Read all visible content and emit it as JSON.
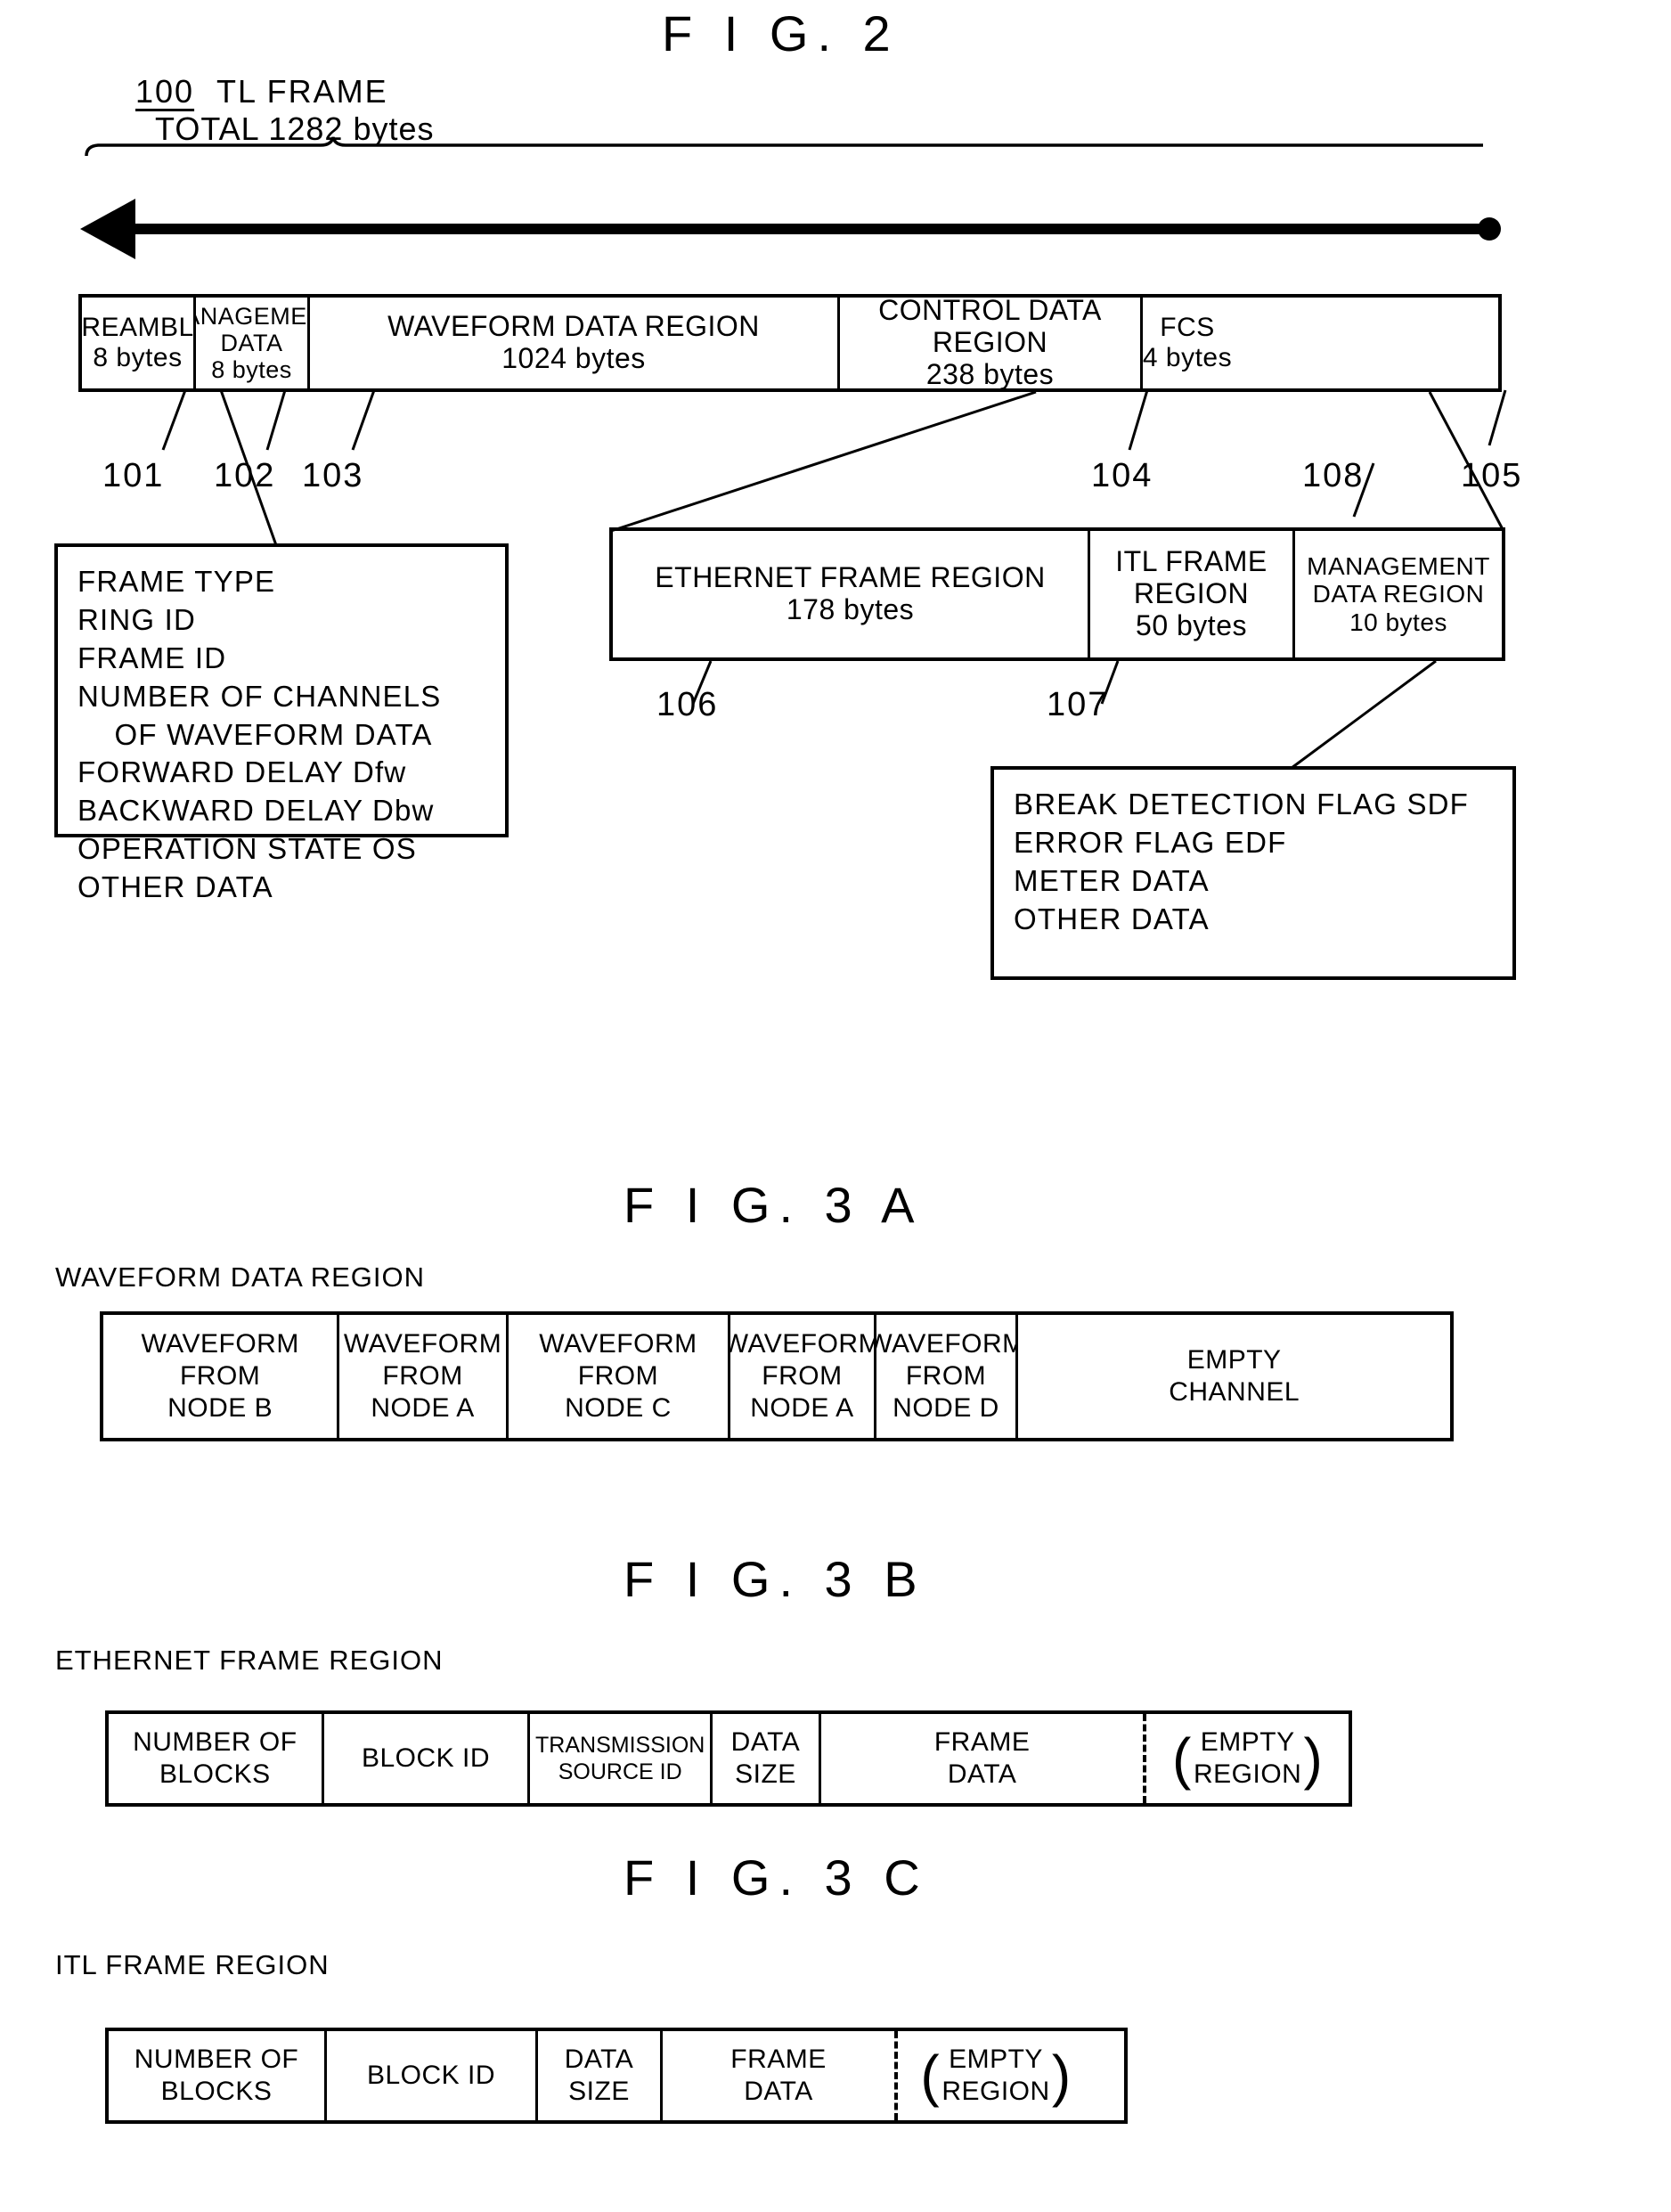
{
  "figures": {
    "fig2": {
      "title": "F I G.  2",
      "frame_ref": "100",
      "frame_name": "TL FRAME",
      "frame_total": "TOTAL 1282 bytes",
      "cells": [
        {
          "ref": "101",
          "lines": [
            "PREAMBLE",
            "8 bytes"
          ]
        },
        {
          "ref": "102",
          "lines": [
            "MANAGEMENT",
            "DATA",
            "8 bytes"
          ]
        },
        {
          "ref": "103",
          "lines": [
            "WAVEFORM DATA REGION",
            "1024 bytes"
          ]
        },
        {
          "ref": "104",
          "lines": [
            "CONTROL DATA",
            "REGION",
            "238 bytes"
          ]
        },
        {
          "ref": "105",
          "lines": [
            "FCS",
            "4 bytes"
          ]
        }
      ],
      "management_detail": [
        "FRAME TYPE",
        "RING ID",
        "FRAME ID",
        "NUMBER OF CHANNELS",
        "    OF WAVEFORM DATA",
        "FORWARD DELAY Dfw",
        "BACKWARD DELAY Dbw",
        "OPERATION STATE OS",
        "OTHER DATA"
      ],
      "control_cells": [
        {
          "ref": "106",
          "lines": [
            "ETHERNET FRAME REGION",
            "178 bytes"
          ]
        },
        {
          "ref": "107",
          "lines": [
            "ITL FRAME",
            "REGION",
            "50 bytes"
          ]
        },
        {
          "ref": "108",
          "lines": [
            "MANAGEMENT",
            "DATA REGION",
            "10 bytes"
          ]
        }
      ],
      "management_region_detail": [
        "BREAK DETECTION FLAG SDF",
        "ERROR FLAG EDF",
        "METER DATA",
        "OTHER DATA"
      ]
    },
    "fig3a": {
      "title": "F I G.  3 A",
      "caption": "WAVEFORM DATA REGION",
      "cells": [
        {
          "lines": [
            "WAVEFORM",
            "FROM",
            "NODE B"
          ]
        },
        {
          "lines": [
            "WAVEFORM",
            "FROM",
            "NODE A"
          ]
        },
        {
          "lines": [
            "WAVEFORM",
            "FROM",
            "NODE C"
          ]
        },
        {
          "lines": [
            "WAVEFORM",
            "FROM",
            "NODE A"
          ]
        },
        {
          "lines": [
            "WAVEFORM",
            "FROM",
            "NODE D"
          ]
        },
        {
          "lines": [
            "EMPTY",
            "CHANNEL"
          ]
        }
      ]
    },
    "fig3b": {
      "title": "F I G.  3 B",
      "caption": "ETHERNET FRAME REGION",
      "cells": [
        {
          "lines": [
            "NUMBER OF",
            "BLOCKS"
          ]
        },
        {
          "lines": [
            "BLOCK ID"
          ]
        },
        {
          "lines": [
            "TRANSMISSION",
            "SOURCE ID"
          ]
        },
        {
          "lines": [
            "DATA",
            "SIZE"
          ]
        },
        {
          "lines": [
            "FRAME",
            "DATA"
          ]
        },
        {
          "lines": [
            "EMPTY",
            "REGION"
          ]
        }
      ]
    },
    "fig3c": {
      "title": "F I G.  3 C",
      "caption": "ITL FRAME REGION",
      "cells": [
        {
          "lines": [
            "NUMBER OF",
            "BLOCKS"
          ]
        },
        {
          "lines": [
            "BLOCK ID"
          ]
        },
        {
          "lines": [
            "DATA",
            "SIZE"
          ]
        },
        {
          "lines": [
            "FRAME",
            "DATA"
          ]
        },
        {
          "lines": [
            "EMPTY",
            "REGION"
          ]
        }
      ]
    }
  },
  "colors": {
    "ink": "#000000",
    "paper": "#ffffff"
  }
}
